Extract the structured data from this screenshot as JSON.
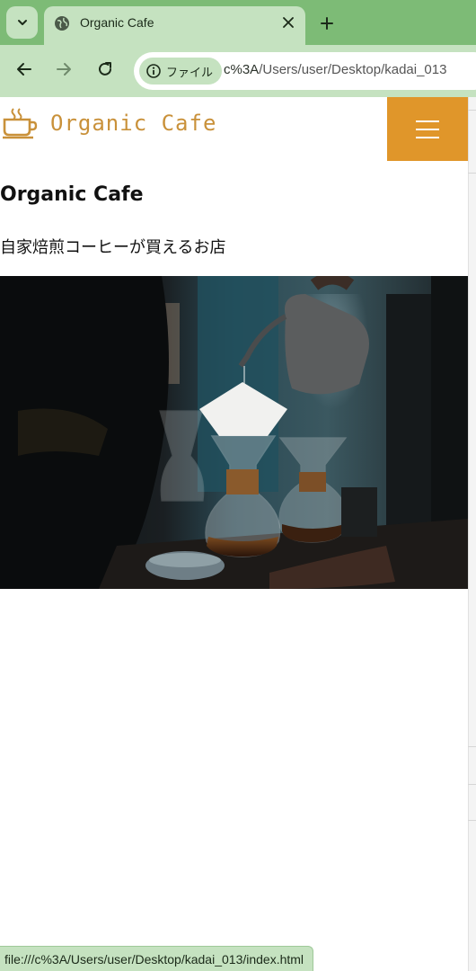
{
  "browser": {
    "tab_title": "Organic Cafe",
    "chip_label": "ファイル",
    "url_prefix": "c%3A",
    "url_rest": "/Users/user/Desktop/kadai_013",
    "status_url": "file:///c%3A/Users/user/Desktop/kadai_013/index.html",
    "icons": [
      "tab-list-icon",
      "globe-icon",
      "close-icon",
      "plus-icon",
      "back-arrow-icon",
      "forward-arrow-icon",
      "reload-icon",
      "info-icon"
    ]
  },
  "site": {
    "logo_text": "Organic Cafe",
    "logo_icon": "coffee-cup-icon",
    "menu_icon": "hamburger-menu-icon",
    "heading": "Organic Cafe",
    "description": "自家焙煎コーヒーが買えるお店"
  },
  "colors": {
    "chrome_dark": "#7dbb76",
    "chrome_light": "#c5e2c0",
    "brand_orange": "#e0962a",
    "logo_gold": "#c9913a"
  }
}
